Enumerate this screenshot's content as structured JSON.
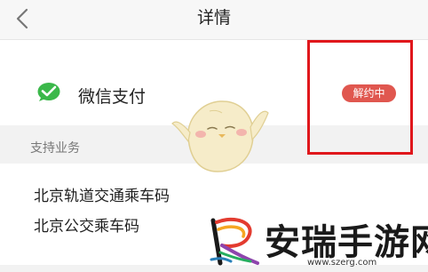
{
  "header": {
    "title": "详情"
  },
  "payment": {
    "name": "微信支付",
    "status": "解约中"
  },
  "services": {
    "title": "支持业务",
    "items": [
      {
        "label": "北京轨道交通乘车码"
      },
      {
        "label": "北京公交乘车码"
      }
    ]
  },
  "watermark": {
    "name": "安瑞手游网",
    "url": "www.szerg.com"
  },
  "colors": {
    "status_badge": "#e0574f",
    "highlight": "#e0171c",
    "wechat": "#3bb84a"
  }
}
